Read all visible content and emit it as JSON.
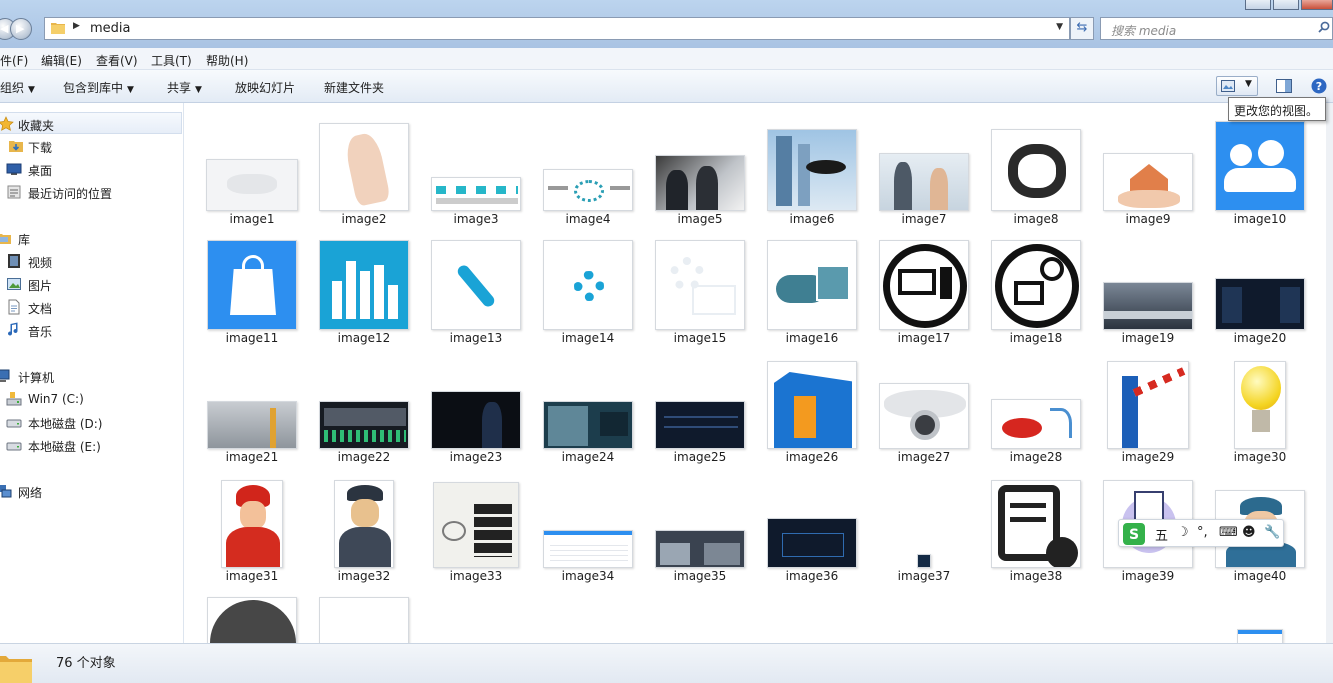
{
  "address": {
    "path": "media"
  },
  "search": {
    "placeholder": "搜索 media"
  },
  "menu": [
    "件(F)",
    "编辑(E)",
    "查看(V)",
    "工具(T)",
    "帮助(H)"
  ],
  "toolbar": {
    "organize": "组织",
    "include_library": "包含到库中",
    "share": "共享",
    "slideshow": "放映幻灯片",
    "new_folder": "新建文件夹"
  },
  "tooltip": "更改您的视图。",
  "sidebar": {
    "favorites": "收藏夹",
    "downloads": "下载",
    "desktop": "桌面",
    "recent": "最近访问的位置",
    "libraries": "库",
    "videos": "视频",
    "pictures": "图片",
    "documents": "文档",
    "music": "音乐",
    "computer": "计算机",
    "drive_c": "Win7 (C:)",
    "drive_d": "本地磁盘 (D:)",
    "drive_e": "本地磁盘 (E:)",
    "network": "网络"
  },
  "files": [
    "image1",
    "image2",
    "image3",
    "image4",
    "image5",
    "image6",
    "image7",
    "image8",
    "image9",
    "image10",
    "image11",
    "image12",
    "image13",
    "image14",
    "image15",
    "image16",
    "image17",
    "image18",
    "image19",
    "image20",
    "image21",
    "image22",
    "image23",
    "image24",
    "image25",
    "image26",
    "image27",
    "image28",
    "image29",
    "image30",
    "image31",
    "image32",
    "image33",
    "image34",
    "image35",
    "image36",
    "image37",
    "image38",
    "image39",
    "image40"
  ],
  "status": {
    "count": "76 个对象"
  },
  "ime": {
    "mode": "五"
  },
  "colors": {
    "accent_blue": "#2d8ff0",
    "cyan": "#1aa3d6",
    "dark_ui": "#0f1a2c"
  }
}
